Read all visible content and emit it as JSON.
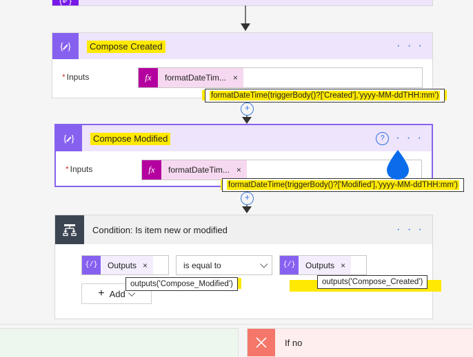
{
  "flow": {
    "partial_top_card": {
      "icon": "compose-icon"
    },
    "compose_created": {
      "title": "Compose Created",
      "icon": "compose-icon",
      "ellipsis": "· · ·",
      "input_label": "Inputs",
      "required_marker": "*",
      "token_badge": "fx",
      "token_text": "formatDateTim...",
      "token_close": "×",
      "tooltip": "formatDateTime(triggerBody()?['Created'],'yyyy-MM-ddTHH:mm')"
    },
    "compose_modified": {
      "title": "Compose Modified",
      "icon": "compose-icon",
      "help": "?",
      "ellipsis": "· · ·",
      "input_label": "Inputs",
      "required_marker": "*",
      "token_badge": "fx",
      "token_text": "formatDateTim...",
      "token_close": "×",
      "tooltip": "formatDateTime(triggerBody()?['Modified'],'yyyy-MM-ddTHH:mm')"
    },
    "condition": {
      "title": "Condition: Is item new or modified",
      "icon": "condition-icon",
      "ellipsis": "· · ·",
      "left_operand": {
        "badge": "{/}",
        "text": "Outputs",
        "close": "×",
        "tooltip": "outputs('Compose_Modified')"
      },
      "operator": {
        "value": "is equal to",
        "chevron": "chevron-down-icon"
      },
      "right_operand": {
        "badge": "{/}",
        "text": "Outputs",
        "close": "×",
        "tooltip": "outputs('Compose_Created')"
      },
      "add_button": {
        "plus": "+",
        "label": "Add",
        "chevron": "chevron-down-icon"
      }
    },
    "branches": {
      "yes": {
        "label": ""
      },
      "no": {
        "label": "If no",
        "icon": "close-x-icon"
      }
    },
    "connectors": {
      "plus_label": "+",
      "arrow": "arrow-down-icon"
    }
  },
  "colors": {
    "compose_accent": "#8661f0",
    "compose_header": "#eee4fb",
    "condition_accent": "#3b4552",
    "fx_badge": "#b4009e",
    "highlight": "#ffe900",
    "link_blue": "#2266e3",
    "branch_no": "#f4776a",
    "branch_yes_bg": "#eef7ee",
    "branch_no_bg": "#feeeed",
    "cursor_blue": "#0a6ceb"
  }
}
